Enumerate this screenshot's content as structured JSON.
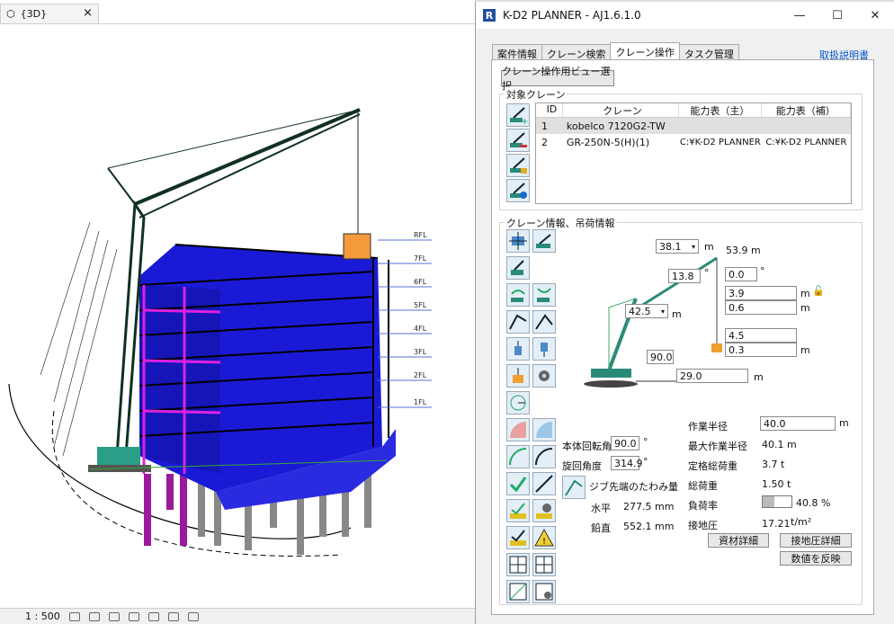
{
  "viewport": {
    "tab_label": "{3D}",
    "close_glyph": "×",
    "floor_labels": [
      "RFL",
      "7FL",
      "6FL",
      "5FL",
      "4FL",
      "3FL",
      "2FL",
      "1FL"
    ],
    "scale": "1 : 500"
  },
  "window": {
    "title": "K-D2 PLANNER - AJ1.6.1.0",
    "tabs": [
      "案件情報",
      "クレーン検索",
      "クレーン操作",
      "タスク管理"
    ],
    "active_tab": "クレーン操作",
    "manual_link": "取扱説明書",
    "view_select_button": "クレーン操作用ビュー選択",
    "target_group_label": "対象クレーン",
    "table": {
      "headers": [
        "ID",
        "クレーン",
        "能力表（主）",
        "能力表（補）"
      ],
      "rows": [
        {
          "id": "1",
          "crane": "kobelco 7120G2-TW",
          "main": "",
          "aux": ""
        },
        {
          "id": "2",
          "crane": "GR-250N-5(H)(1)",
          "main": "C:¥K-D2 PLANNER",
          "aux": "C:¥K-D2 PLANNER"
        }
      ]
    },
    "info_group_label": "クレーン情報、吊荷情報",
    "diagram": {
      "boom_length": "38.1",
      "boom_length_unit": "m",
      "jib_length_text": "53.9 m",
      "boom_angle": "13.8",
      "deg_unit": "°",
      "offset_angle": "0.0",
      "v1": "3.9",
      "v2": "0.6",
      "v3": "4.5",
      "v4": "0.3",
      "main_boom": "42.5",
      "base_angle": "90.0",
      "radius_val": "29.0",
      "m": "m"
    },
    "rotation_label": "本体回転角",
    "rotation_value": "90.0",
    "slew_label": "旋回角度",
    "slew_value": "314.9",
    "deflection_label": "ジブ先端のたわみ量",
    "horizontal_label": "水平",
    "horizontal_value": "277.5 mm",
    "vertical_label": "鉛直",
    "vertical_value": "552.1 mm",
    "work_radius_label": "作業半径",
    "work_radius_value": "40.0",
    "max_radius_label": "最大作業半径",
    "max_radius_value": "40.1 m",
    "rated_load_label": "定格総荷重",
    "rated_load_value": "3.7 t",
    "total_load_label": "総荷重",
    "total_load_value": "1.50 t",
    "load_rate_label": "負荷率",
    "load_rate_value": "40.8 %",
    "load_rate_fraction": 0.408,
    "ground_pressure_label": "接地圧",
    "ground_pressure_value": "17.21",
    "ground_pressure_unit": "t/m²",
    "material_button": "資材詳細",
    "pressure_button": "接地圧詳細",
    "apply_button": "数値を反映",
    "controls": [
      "—",
      "☐",
      "✕"
    ]
  }
}
